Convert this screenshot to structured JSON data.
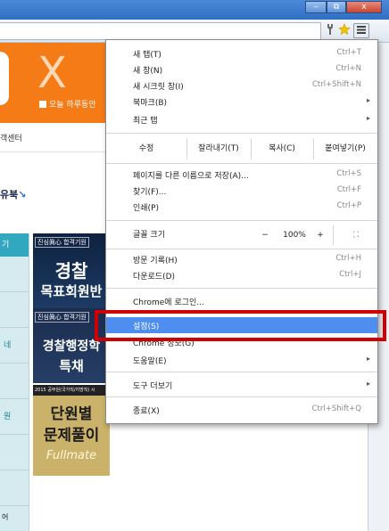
{
  "window": {
    "minimize_label": "‒",
    "restore_label": "⧉",
    "close_label": "x"
  },
  "toolbar": {
    "wrench_icon": "wrench-icon",
    "star_icon": "star-icon",
    "menu_icon": "menu-icon"
  },
  "page": {
    "today_checkbox_label": "오늘 하루동안",
    "customer_center_tab": "객센터",
    "snippet_text": "유북",
    "left_nav": {
      "head": "기",
      "rows": [
        "",
        "",
        "네",
        "",
        "원",
        "",
        "",
        "네"
      ],
      "tail": "어"
    },
    "ads": {
      "ad1": {
        "tag": "진심眞心 합격기원",
        "line1": "경찰",
        "line2": "목표회원반"
      },
      "ad2": {
        "tag": "진심眞心 합격기원",
        "line1": "경찰행정학",
        "line2": "특채"
      },
      "ad3": {
        "strip": "2015 공무원(국가직/지방직) 시",
        "line1": "단원별",
        "line2": "문제풀이",
        "line3": "Fullmate"
      }
    }
  },
  "menu": {
    "items_top": [
      {
        "label": "새 탭(T)",
        "shortcut": "Ctrl+T"
      },
      {
        "label": "새 창(N)",
        "shortcut": "Ctrl+N"
      },
      {
        "label": "새 시크릿 창(I)",
        "shortcut": "Ctrl+Shift+N"
      },
      {
        "label": "북마크(B)",
        "shortcut": "▸"
      },
      {
        "label": "최근 탭",
        "shortcut": "▸"
      }
    ],
    "edit": {
      "label": "수정",
      "cut": "잘라내기(T)",
      "copy": "복사(C)",
      "paste": "붙여넣기(P)"
    },
    "items_page": [
      {
        "label": "페이지를 다른 이름으로 저장(A)...",
        "shortcut": "Ctrl+S"
      },
      {
        "label": "찾기(F)...",
        "shortcut": "Ctrl+F"
      },
      {
        "label": "인쇄(P)",
        "shortcut": "Ctrl+P"
      }
    ],
    "zoom": {
      "label": "글꼴 크기",
      "minus": "−",
      "value": "100%",
      "plus": "+",
      "fullscreen": "⛶"
    },
    "items_history": [
      {
        "label": "방문 기록(H)",
        "shortcut": "Ctrl+H"
      },
      {
        "label": "다운로드(D)",
        "shortcut": "Ctrl+J"
      }
    ],
    "sign_in": "Chrome에 로그인...",
    "settings": "설정(S)",
    "about": "Chrome 정보(G)",
    "help": {
      "label": "도움말(E)",
      "arrow": "▸"
    },
    "more_tools": {
      "label": "도구 더보기",
      "arrow": "▸"
    },
    "exit": {
      "label": "종료(X)",
      "shortcut": "Ctrl+Shift+Q"
    }
  }
}
